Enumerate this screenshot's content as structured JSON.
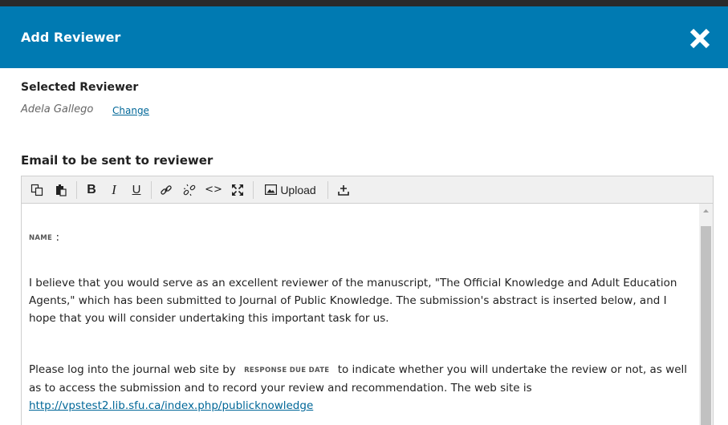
{
  "dialog": {
    "title": "Add Reviewer"
  },
  "selected_reviewer": {
    "label": "Selected Reviewer",
    "name": "Adela Gallego",
    "change_link": "Change"
  },
  "email": {
    "label": "Email to be sent to reviewer",
    "toolbar": {
      "upload_label": "Upload"
    },
    "body": {
      "greeting_var": "NAME",
      "greeting_suffix": ":",
      "para1": "I believe that you would serve as an excellent reviewer of the manuscript, \"The Official Knowledge and Adult Education Agents,\" which has been submitted to Journal of Public Knowledge. The submission's abstract is inserted below, and I hope that you will consider undertaking this important task for us.",
      "para2_before": "Please log into the journal web site by",
      "due_var": "RESPONSE DUE DATE",
      "para2_after": "to indicate whether you will undertake the review or not, as well as to access the submission and to record your review and recommendation. The web site is",
      "link": "http://vpstest2.lib.sfu.ca/index.php/publicknowledge"
    }
  },
  "colors": {
    "header_bg": "#007ab2",
    "link": "#006798"
  }
}
